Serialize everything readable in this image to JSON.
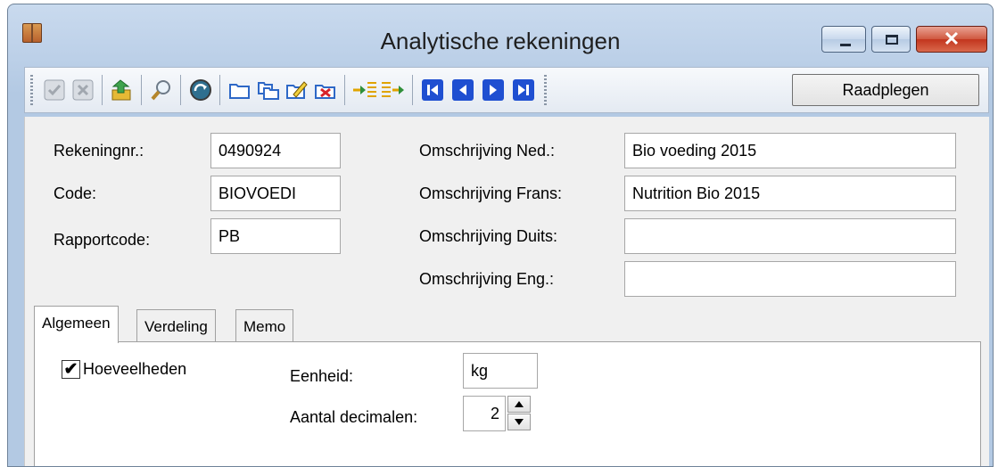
{
  "window": {
    "title": "Analytische rekeningen",
    "close_glyph": "✕"
  },
  "toolbar": {
    "icons": [
      "confirm-icon",
      "cancel-icon",
      "export-icon",
      "search-icon",
      "refresh-icon",
      "folder-icon",
      "copy-icon",
      "edit-icon",
      "delete-icon",
      "move-in-icon",
      "move-out-icon",
      "first-record-icon",
      "previous-record-icon",
      "next-record-icon",
      "last-record-icon"
    ],
    "mode_button": "Raadplegen"
  },
  "form": {
    "account_no_label": "Rekeningnr.:",
    "account_no_value": "0490924",
    "code_label": "Code:",
    "code_value": "BIOVOEDI",
    "report_code_label": "Rapportcode:",
    "report_code_value": "PB",
    "desc_nl_label": "Omschrijving Ned.:",
    "desc_nl_value": "Bio voeding 2015",
    "desc_fr_label": "Omschrijving Frans:",
    "desc_fr_value": "Nutrition Bio 2015",
    "desc_de_label": "Omschrijving Duits:",
    "desc_de_value": "",
    "desc_en_label": "Omschrijving Eng.:",
    "desc_en_value": ""
  },
  "tabs": [
    {
      "label": "Algemeen",
      "active": true
    },
    {
      "label": "Verdeling",
      "active": false
    },
    {
      "label": "Memo",
      "active": false
    }
  ],
  "general": {
    "quantities_label": "Hoeveelheden",
    "quantities_checked": true,
    "check_glyph": "✔",
    "unit_label": "Eenheid:",
    "unit_value": "kg",
    "decimals_label": "Aantal decimalen:",
    "decimals_value": "2"
  },
  "colors": {
    "titlebar": "#bcd0e8",
    "nav_blue": "#1f4fd1",
    "close_red": "#c2351e"
  }
}
